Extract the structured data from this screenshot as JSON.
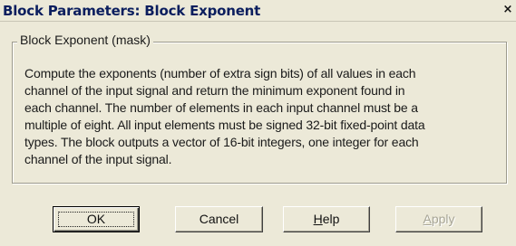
{
  "window": {
    "title": "Block Parameters: Block Exponent",
    "close_glyph": "×",
    "close_icon": "close-icon"
  },
  "group": {
    "legend": "Block Exponent (mask)",
    "description": "Compute the exponents (number of extra sign bits) of all values in each\nchannel of the input signal and return the minimum exponent found in\neach channel. The number of elements in each input channel must be a\nmultiple of eight. All input elements must be signed 32-bit fixed-point data\ntypes. The block outputs a vector of 16-bit integers, one integer for each\nchannel of the input signal."
  },
  "buttons": {
    "ok": "OK",
    "cancel": "Cancel",
    "help_first": "H",
    "help_rest": "elp",
    "apply_first": "A",
    "apply_rest": "pply",
    "apply_enabled": false
  },
  "colors": {
    "dialog_bg": "#ece9d8",
    "title_text": "#0b1e5e",
    "disabled_text": "#a7a596"
  }
}
